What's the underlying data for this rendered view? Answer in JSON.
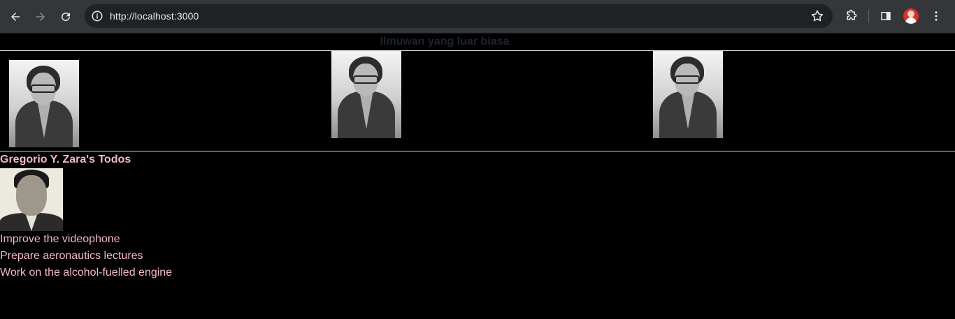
{
  "browser": {
    "url": "http://localhost:3000",
    "icons": {
      "back": "arrow-left-icon",
      "forward": "arrow-right-icon",
      "reload": "reload-icon",
      "site_info": "info-icon",
      "bookmark": "star-icon",
      "extensions": "puzzle-icon",
      "side_panel": "side-panel-icon",
      "profile": "avatar",
      "menu": "kebab-menu-icon"
    }
  },
  "page": {
    "heading": "Ilmuwan yang luar biasa",
    "gallery": [
      {
        "alt": "Katherine Johnson"
      },
      {
        "alt": "Katherine Johnson"
      },
      {
        "alt": "Katherine Johnson"
      }
    ],
    "todos_title": "Gregorio Y. Zara's Todos",
    "todos": [
      "Improve the videophone",
      "Prepare aeronautics lectures",
      "Work on the alcohol-fuelled engine"
    ]
  },
  "colors": {
    "background": "#000000",
    "text_pink": "#f4b8c6",
    "heading": "#1e2330",
    "chrome": "#35363a",
    "omnibox": "#202124"
  }
}
